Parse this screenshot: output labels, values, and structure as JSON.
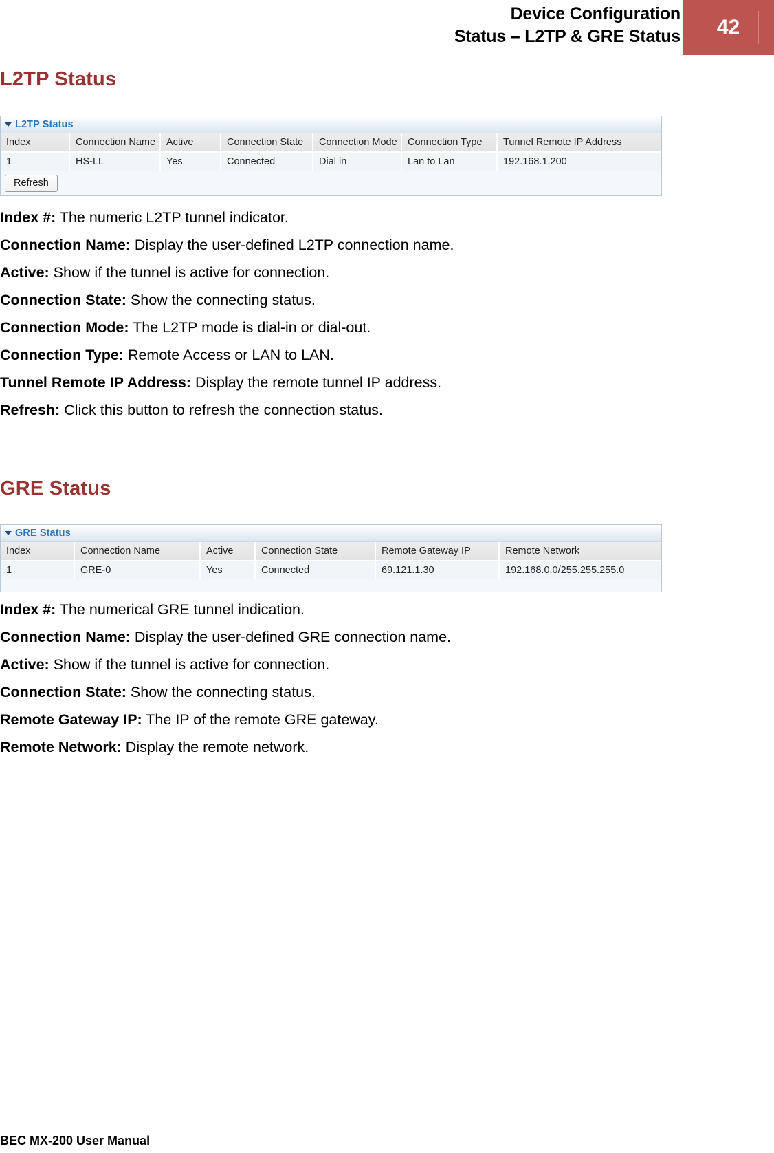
{
  "header": {
    "title_line1": "Device Configuration",
    "title_line2": "Status – L2TP & GRE Status",
    "page_number": "42",
    "accent_color": "#bd5450"
  },
  "sections": {
    "l2tp": {
      "heading": "L2TP Status",
      "panel_title": "L2TP Status",
      "caret_icon": "caret-down-icon",
      "table": {
        "columns": [
          "Index",
          "Connection Name",
          "Active",
          "Connection State",
          "Connection Mode",
          "Connection Type",
          "Tunnel Remote IP Address"
        ],
        "rows": [
          [
            "1",
            "HS-LL",
            "Yes",
            "Connected",
            "Dial in",
            "Lan to Lan",
            "192.168.1.200"
          ]
        ]
      },
      "refresh_label": "Refresh",
      "definitions": [
        {
          "term": "Index #:",
          "text": " The numeric L2TP tunnel indicator."
        },
        {
          "term": "Connection Name:",
          "text": " Display the user-defined L2TP connection name."
        },
        {
          "term": "Active:",
          "text": " Show if the tunnel is active for connection."
        },
        {
          "term": "Connection State:",
          "text": " Show the connecting status."
        },
        {
          "term": "Connection Mode:",
          "text": " The L2TP mode is dial-in or dial-out."
        },
        {
          "term": "Connection Type:",
          "text": " Remote Access or LAN to LAN."
        },
        {
          "term": "Tunnel Remote IP Address:",
          "text": " Display the remote tunnel IP address."
        },
        {
          "term": "Refresh:",
          "text": " Click this button to refresh the connection status."
        }
      ]
    },
    "gre": {
      "heading": "GRE Status",
      "panel_title": "GRE Status",
      "caret_icon": "caret-down-icon",
      "table": {
        "columns": [
          "Index",
          "Connection Name",
          "Active",
          "Connection State",
          "Remote Gateway IP",
          "Remote Network"
        ],
        "rows": [
          [
            "1",
            "GRE-0",
            "Yes",
            "Connected",
            "69.121.1.30",
            "192.168.0.0/255.255.255.0"
          ]
        ]
      },
      "definitions": [
        {
          "term": "Index #:",
          "text": "  The numerical GRE tunnel indication."
        },
        {
          "term": "Connection Name:",
          "text": " Display the user-defined GRE connection name."
        },
        {
          "term": "Active:",
          "text": " Show if the tunnel is active for connection."
        },
        {
          "term": "Connection State:",
          "text": " Show the connecting status."
        },
        {
          "term": "Remote Gateway IP:",
          "text": " The IP of the remote GRE gateway."
        },
        {
          "term": "Remote Network:",
          "text": " Display the remote network."
        }
      ]
    }
  },
  "footer": {
    "text": "BEC MX-200 User Manual"
  }
}
